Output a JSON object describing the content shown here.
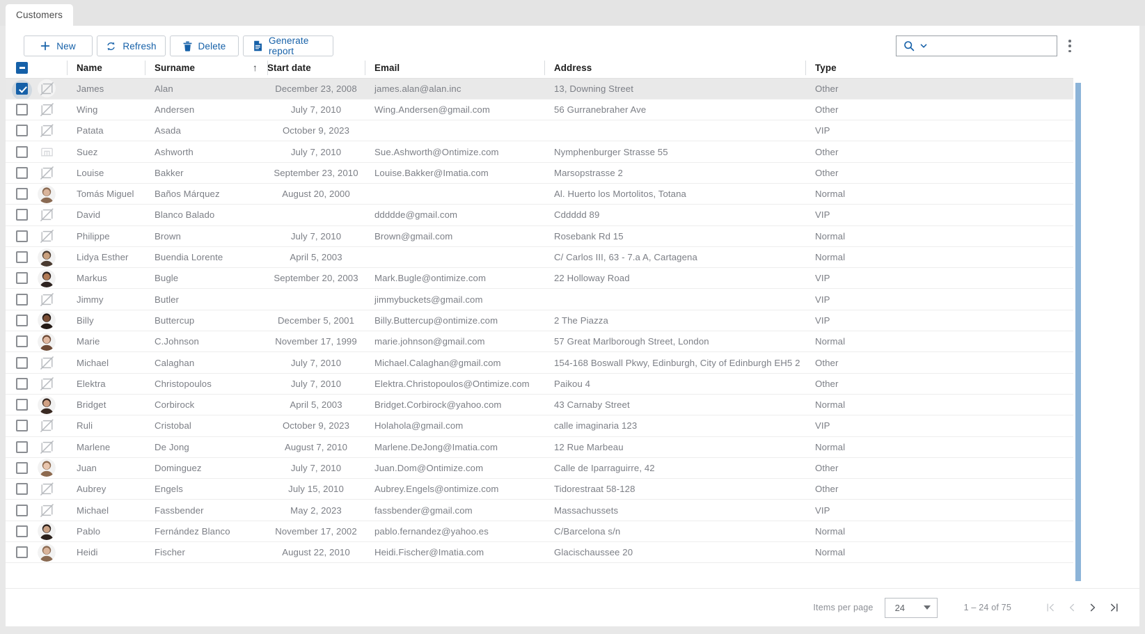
{
  "tab": {
    "label": "Customers"
  },
  "toolbar": {
    "new_label": "New",
    "refresh_label": "Refresh",
    "delete_label": "Delete",
    "report_label": "Generate report",
    "search_value": "",
    "search_placeholder": ""
  },
  "columns": {
    "name": "Name",
    "surname": "Surname",
    "start_date": "Start date",
    "email": "Email",
    "address": "Address",
    "type": "Type",
    "sort_indicator": "↑",
    "sorted_by": "surname",
    "sort_direction": "asc"
  },
  "paginator": {
    "items_per_page_label": "Items per page",
    "page_size": "24",
    "range_label": "1 – 24 of 75"
  },
  "rows": [
    {
      "selected": true,
      "avatar": "image-off-icon",
      "name": "James",
      "surname": "Alan",
      "start_date": "December 23, 2008",
      "email": "james.alan@alan.inc",
      "address": "13, Downing Street",
      "type": "Other"
    },
    {
      "selected": false,
      "avatar": "image-off-icon",
      "name": "Wing",
      "surname": "Andersen",
      "start_date": "July 7, 2010",
      "email": "Wing.Andersen@gmail.com",
      "address": "56 Gurranebraher Ave",
      "type": "Other"
    },
    {
      "selected": false,
      "avatar": "image-off-icon",
      "name": "Patata",
      "surname": "Asada",
      "start_date": "October 9, 2023",
      "email": "",
      "address": "",
      "type": "VIP"
    },
    {
      "selected": false,
      "avatar": "image-broken-icon",
      "name": "Suez",
      "surname": "Ashworth",
      "start_date": "July 7, 2010",
      "email": "Sue.Ashworth@Ontimize.com",
      "address": "Nymphenburger Strasse 55",
      "type": "Other"
    },
    {
      "selected": false,
      "avatar": "image-off-icon",
      "name": "Louise",
      "surname": "Bakker",
      "start_date": "September 23, 2010",
      "email": "Louise.Bakker@Imatia.com",
      "address": "Marsopstrasse 2",
      "type": "Other"
    },
    {
      "selected": false,
      "avatar": "photo",
      "name": "Tomás Miguel",
      "surname": "Baños Márquez",
      "start_date": "August 20, 2000",
      "email": "",
      "address": "Al. Huerto los Mortolitos, Totana",
      "type": "Normal"
    },
    {
      "selected": false,
      "avatar": "image-off-icon",
      "name": "David",
      "surname": "Blanco Balado",
      "start_date": "",
      "email": "dddddе@gmail.com",
      "address": "Cddddd 89",
      "type": "VIP"
    },
    {
      "selected": false,
      "avatar": "image-off-icon",
      "name": "Philippe",
      "surname": "Brown",
      "start_date": "July 7, 2010",
      "email": "Brown@gmail.com",
      "address": "Rosebank Rd 15",
      "type": "Normal"
    },
    {
      "selected": false,
      "avatar": "photo",
      "name": "Lidya Esther",
      "surname": "Buendia Lorente",
      "start_date": "April 5, 2003",
      "email": "",
      "address": "C/ Carlos III, 63 - 7.a A, Cartagena",
      "type": "Normal"
    },
    {
      "selected": false,
      "avatar": "photo",
      "name": "Markus",
      "surname": "Bugle",
      "start_date": "September 20, 2003",
      "email": "Mark.Bugle@ontimize.com",
      "address": "22 Holloway Road",
      "type": "VIP"
    },
    {
      "selected": false,
      "avatar": "image-off-icon",
      "name": "Jimmy",
      "surname": "Butler",
      "start_date": "",
      "email": "jimmybuckets@gmail.com",
      "address": "",
      "type": "VIP"
    },
    {
      "selected": false,
      "avatar": "photo",
      "name": "Billy",
      "surname": "Buttercup",
      "start_date": "December 5, 2001",
      "email": "Billy.Buttercup@ontimize.com",
      "address": "2 The Piazza",
      "type": "VIP"
    },
    {
      "selected": false,
      "avatar": "photo",
      "name": "Marie",
      "surname": "C.Johnson",
      "start_date": "November 17, 1999",
      "email": "marie.johnson@gmail.com",
      "address": "57 Great Marlborough Street, London",
      "type": "Normal"
    },
    {
      "selected": false,
      "avatar": "image-off-icon",
      "name": "Michael",
      "surname": "Calaghan",
      "start_date": "July 7, 2010",
      "email": "Michael.Calaghan@gmail.com",
      "address": "154-168 Boswall Pkwy, Edinburgh, City of Edinburgh EH5 2",
      "type": "Other"
    },
    {
      "selected": false,
      "avatar": "image-off-icon",
      "name": "Elektra",
      "surname": "Christopoulos",
      "start_date": "July 7, 2010",
      "email": "Elektra.Christopoulos@Ontimize.com",
      "address": "Paikou 4",
      "type": "Other"
    },
    {
      "selected": false,
      "avatar": "photo",
      "name": "Bridget",
      "surname": "Corbirock",
      "start_date": "April 5, 2003",
      "email": "Bridget.Corbirock@yahoo.com",
      "address": "43 Carnaby Street",
      "type": "Normal"
    },
    {
      "selected": false,
      "avatar": "image-off-icon",
      "name": "Ruli",
      "surname": "Cristobal",
      "start_date": "October 9, 2023",
      "email": "Holahola@gmail.com",
      "address": "calle imaginaria 123",
      "type": "VIP"
    },
    {
      "selected": false,
      "avatar": "image-off-icon",
      "name": "Marlene",
      "surname": "De Jong",
      "start_date": "August 7, 2010",
      "email": "Marlene.DeJong@Imatia.com",
      "address": "12 Rue Marbeau",
      "type": "Normal"
    },
    {
      "selected": false,
      "avatar": "photo",
      "name": "Juan",
      "surname": "Dominguez",
      "start_date": "July 7, 2010",
      "email": "Juan.Dom@Ontimize.com",
      "address": "Calle de Iparraguirre, 42",
      "type": "Other"
    },
    {
      "selected": false,
      "avatar": "image-off-icon",
      "name": "Aubrey",
      "surname": "Engels",
      "start_date": "July 15, 2010",
      "email": "Aubrey.Engels@ontimize.com",
      "address": "Tidorestraat 58-128",
      "type": "Other"
    },
    {
      "selected": false,
      "avatar": "image-off-icon",
      "name": "Michael",
      "surname": "Fassbender",
      "start_date": "May 2, 2023",
      "email": "fassbender@gmail.com",
      "address": "Massachussets",
      "type": "VIP"
    },
    {
      "selected": false,
      "avatar": "photo",
      "name": "Pablo",
      "surname": "Fernández Blanco",
      "start_date": "November 17, 2002",
      "email": "pablo.fernandez@yahoo.es",
      "address": "C/Barcelona s/n",
      "type": "Normal"
    },
    {
      "selected": false,
      "avatar": "photo",
      "name": "Heidi",
      "surname": "Fischer",
      "start_date": "August 22, 2010",
      "email": "Heidi.Fischer@Imatia.com",
      "address": "Glacischaussee 20",
      "type": "Normal"
    }
  ],
  "colors": {
    "accent": "#1560a8",
    "selected_row_bg": "#e9e9e9",
    "scrollbar_thumb": "#8cb4d8",
    "text_muted": "#7c7f86"
  }
}
